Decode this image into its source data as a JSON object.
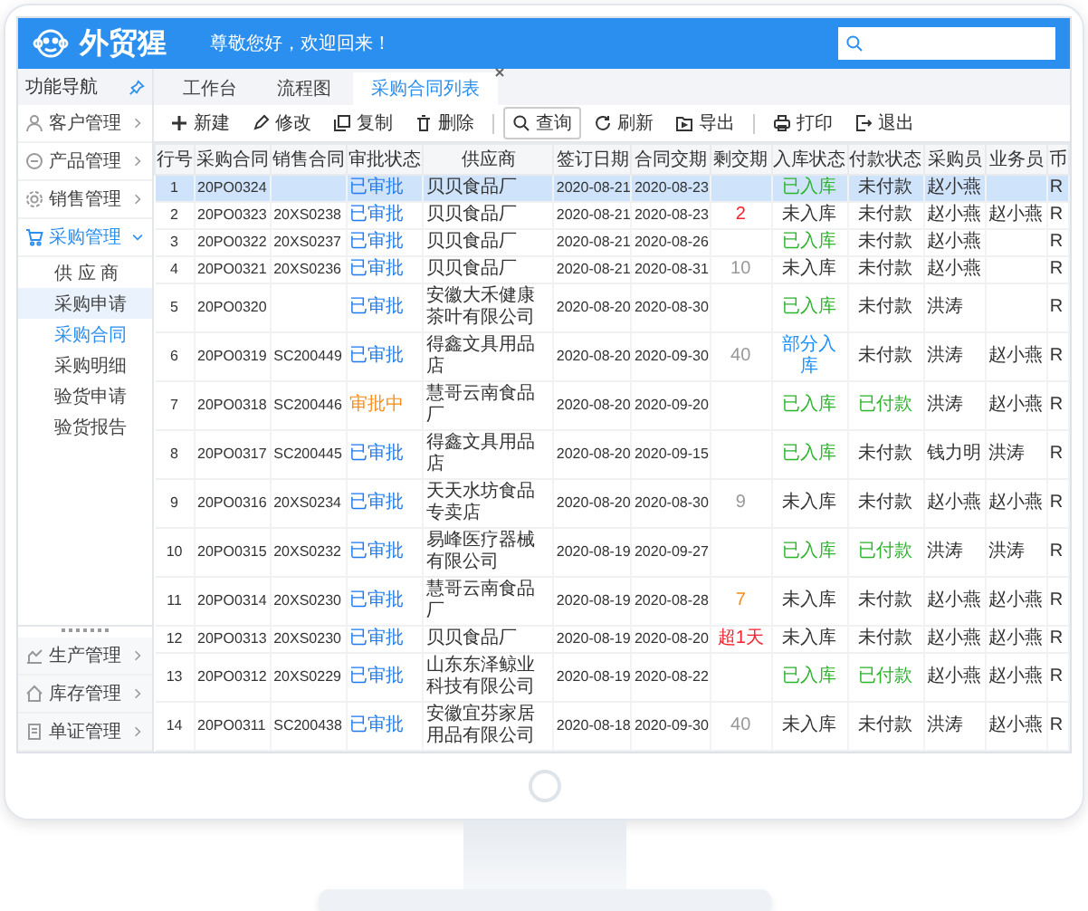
{
  "header": {
    "logo": "外贸猩",
    "greeting": "尊敬您好，欢迎回来！"
  },
  "sidebar": {
    "title": "功能导航",
    "items": [
      {
        "label": "客户管理",
        "expanded": false
      },
      {
        "label": "产品管理",
        "expanded": false
      },
      {
        "label": "销售管理",
        "expanded": false
      },
      {
        "label": "采购管理",
        "expanded": true,
        "children": [
          {
            "label": "供 应 商",
            "selected": false,
            "hovered": false
          },
          {
            "label": "采购申请",
            "selected": false,
            "hovered": true
          },
          {
            "label": "采购合同",
            "selected": true,
            "hovered": false
          },
          {
            "label": "采购明细",
            "selected": false,
            "hovered": false
          },
          {
            "label": "验货申请",
            "selected": false,
            "hovered": false
          },
          {
            "label": "验货报告",
            "selected": false,
            "hovered": false
          }
        ]
      }
    ],
    "bottom_items": [
      {
        "label": "生产管理",
        "expanded": false
      },
      {
        "label": "库存管理",
        "expanded": false
      },
      {
        "label": "单证管理",
        "expanded": false
      }
    ]
  },
  "tabs": [
    {
      "label": "工作台",
      "selected": false
    },
    {
      "label": "流程图",
      "selected": false
    },
    {
      "label": "采购合同列表",
      "selected": true
    }
  ],
  "toolbar": [
    [
      {
        "label": "新建",
        "outlined": false
      },
      {
        "label": "修改",
        "outlined": false
      },
      {
        "label": "复制",
        "outlined": false
      },
      {
        "label": "删除",
        "outlined": false
      }
    ],
    [
      {
        "label": "查询",
        "outlined": true
      },
      {
        "label": "刷新",
        "outlined": false
      },
      {
        "label": "导出",
        "outlined": false
      }
    ],
    [
      {
        "label": "打印",
        "outlined": false
      },
      {
        "label": "退出",
        "outlined": false
      }
    ]
  ],
  "table": {
    "columns": [
      "行号",
      "采购合同",
      "销售合同",
      "审批状态",
      "供应商",
      "签订日期",
      "合同交期",
      "剩交期",
      "入库状态",
      "付款状态",
      "采购员",
      "业务员",
      "币"
    ],
    "rows": [
      {
        "selected": true,
        "no": "1",
        "po": "20PO0324",
        "approval": {
          "text": "已审批",
          "color": "#1e7bf0"
        },
        "supplier": "贝贝食品厂",
        "signed": "2020-08-21",
        "due": "2020-08-23",
        "stock": {
          "text": "已入库",
          "color": "#2db52d"
        },
        "payment": {
          "text": "未付款",
          "color": "#333333"
        },
        "buyer": "赵小燕",
        "currency": "R"
      },
      {
        "selected": false,
        "no": "2",
        "po": "20PO0323",
        "so": "20XS0238",
        "approval": {
          "text": "已审批",
          "color": "#1e7bf0"
        },
        "supplier": "贝贝食品厂",
        "signed": "2020-08-21",
        "due": "2020-08-23",
        "remaining": {
          "text": "2",
          "color": "#f5222d"
        },
        "stock": {
          "text": "未入库",
          "color": "#333333"
        },
        "payment": {
          "text": "未付款",
          "color": "#333333"
        },
        "buyer": "赵小燕",
        "sales": "赵小燕",
        "currency": "R"
      },
      {
        "selected": false,
        "no": "3",
        "po": "20PO0322",
        "so": "20XS0237",
        "approval": {
          "text": "已审批",
          "color": "#1e7bf0"
        },
        "supplier": "贝贝食品厂",
        "signed": "2020-08-21",
        "due": "2020-08-26",
        "stock": {
          "text": "已入库",
          "color": "#2db52d"
        },
        "payment": {
          "text": "未付款",
          "color": "#333333"
        },
        "buyer": "赵小燕",
        "currency": "R"
      },
      {
        "selected": false,
        "no": "4",
        "po": "20PO0321",
        "so": "20XS0236",
        "approval": {
          "text": "已审批",
          "color": "#1e7bf0"
        },
        "supplier": "贝贝食品厂",
        "signed": "2020-08-21",
        "due": "2020-08-31",
        "remaining": {
          "text": "10",
          "color": "#999999"
        },
        "stock": {
          "text": "未入库",
          "color": "#333333"
        },
        "payment": {
          "text": "未付款",
          "color": "#333333"
        },
        "buyer": "赵小燕",
        "currency": "R"
      },
      {
        "selected": false,
        "no": "5",
        "po": "20PO0320",
        "approval": {
          "text": "已审批",
          "color": "#1e7bf0"
        },
        "supplier": "安徽大禾健康茶叶有限公司",
        "signed": "2020-08-20",
        "due": "2020-08-30",
        "stock": {
          "text": "已入库",
          "color": "#2db52d"
        },
        "payment": {
          "text": "未付款",
          "color": "#333333"
        },
        "buyer": "洪涛",
        "currency": "R"
      },
      {
        "selected": false,
        "no": "6",
        "po": "20PO0319",
        "so": "SC200449",
        "approval": {
          "text": "已审批",
          "color": "#1e7bf0"
        },
        "supplier": "得鑫文具用品店",
        "signed": "2020-08-20",
        "due": "2020-09-30",
        "remaining": {
          "text": "40",
          "color": "#999999"
        },
        "stock": {
          "text": "部分入库",
          "color": "#1890ff"
        },
        "payment": {
          "text": "未付款",
          "color": "#333333"
        },
        "buyer": "洪涛",
        "sales": "赵小燕",
        "currency": "R"
      },
      {
        "selected": false,
        "no": "7",
        "po": "20PO0318",
        "so": "SC200446",
        "approval": {
          "text": "审批中",
          "color": "#fa8c16"
        },
        "supplier": "慧哥云南食品厂",
        "signed": "2020-08-20",
        "due": "2020-09-20",
        "stock": {
          "text": "已入库",
          "color": "#2db52d"
        },
        "payment": {
          "text": "已付款",
          "color": "#2db52d"
        },
        "buyer": "洪涛",
        "sales": "赵小燕",
        "currency": "R"
      },
      {
        "selected": false,
        "no": "8",
        "po": "20PO0317",
        "so": "SC200445",
        "approval": {
          "text": "已审批",
          "color": "#1e7bf0"
        },
        "supplier": "得鑫文具用品店",
        "signed": "2020-08-20",
        "due": "2020-09-15",
        "stock": {
          "text": "已入库",
          "color": "#2db52d"
        },
        "payment": {
          "text": "未付款",
          "color": "#333333"
        },
        "buyer": "钱力明",
        "sales": "洪涛",
        "currency": "R"
      },
      {
        "selected": false,
        "no": "9",
        "po": "20PO0316",
        "so": "20XS0234",
        "approval": {
          "text": "已审批",
          "color": "#1e7bf0"
        },
        "supplier": "天天水坊食品专卖店",
        "signed": "2020-08-20",
        "due": "2020-08-30",
        "remaining": {
          "text": "9",
          "color": "#999999"
        },
        "stock": {
          "text": "未入库",
          "color": "#333333"
        },
        "payment": {
          "text": "未付款",
          "color": "#333333"
        },
        "buyer": "赵小燕",
        "sales": "赵小燕",
        "currency": "R"
      },
      {
        "selected": false,
        "no": "10",
        "po": "20PO0315",
        "so": "20XS0232",
        "approval": {
          "text": "已审批",
          "color": "#1e7bf0"
        },
        "supplier": "易峰医疗器械有限公司",
        "signed": "2020-08-19",
        "due": "2020-09-27",
        "stock": {
          "text": "已入库",
          "color": "#2db52d"
        },
        "payment": {
          "text": "已付款",
          "color": "#2db52d"
        },
        "buyer": "洪涛",
        "sales": "洪涛",
        "currency": "R"
      },
      {
        "selected": false,
        "no": "11",
        "po": "20PO0314",
        "so": "20XS0230",
        "approval": {
          "text": "已审批",
          "color": "#1e7bf0"
        },
        "supplier": "慧哥云南食品厂",
        "signed": "2020-08-19",
        "due": "2020-08-28",
        "remaining": {
          "text": "7",
          "color": "#fa8c16"
        },
        "stock": {
          "text": "未入库",
          "color": "#333333"
        },
        "payment": {
          "text": "未付款",
          "color": "#333333"
        },
        "buyer": "赵小燕",
        "sales": "赵小燕",
        "currency": "R"
      },
      {
        "selected": false,
        "no": "12",
        "po": "20PO0313",
        "so": "20XS0230",
        "approval": {
          "text": "已审批",
          "color": "#1e7bf0"
        },
        "supplier": "贝贝食品厂",
        "signed": "2020-08-19",
        "due": "2020-08-20",
        "remaining": {
          "text": "超1天",
          "color": "#f5222d"
        },
        "stock": {
          "text": "未入库",
          "color": "#333333"
        },
        "payment": {
          "text": "未付款",
          "color": "#333333"
        },
        "buyer": "赵小燕",
        "sales": "赵小燕",
        "currency": "R"
      },
      {
        "selected": false,
        "no": "13",
        "po": "20PO0312",
        "so": "20XS0229",
        "approval": {
          "text": "已审批",
          "color": "#1e7bf0"
        },
        "supplier": "山东东泽鲸业科技有限公司",
        "signed": "2020-08-19",
        "due": "2020-08-22",
        "stock": {
          "text": "已入库",
          "color": "#2db52d"
        },
        "payment": {
          "text": "已付款",
          "color": "#2db52d"
        },
        "buyer": "赵小燕",
        "sales": "赵小燕",
        "currency": "R"
      },
      {
        "selected": false,
        "no": "14",
        "po": "20PO0311",
        "so": "SC200438",
        "approval": {
          "text": "已审批",
          "color": "#1e7bf0"
        },
        "supplier": "安徽宜芬家居用品有限公司",
        "signed": "2020-08-18",
        "due": "2020-09-30",
        "remaining": {
          "text": "40",
          "color": "#999999"
        },
        "stock": {
          "text": "未入库",
          "color": "#333333"
        },
        "payment": {
          "text": "未付款",
          "color": "#333333"
        },
        "buyer": "洪涛",
        "sales": "赵小燕",
        "currency": "R"
      }
    ]
  }
}
